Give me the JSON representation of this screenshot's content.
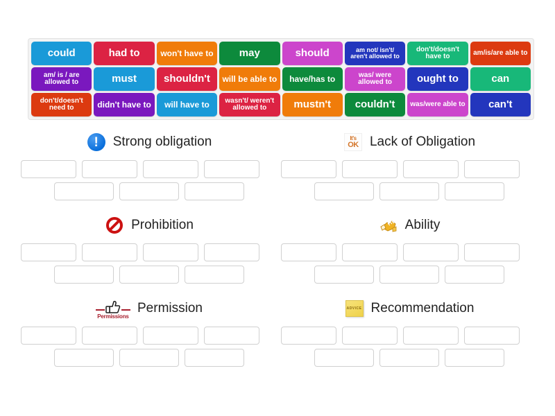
{
  "tile_bank": {
    "rows": [
      [
        {
          "label": "could",
          "color": "#1a9ad8",
          "size": "big"
        },
        {
          "label": "had to",
          "color": "#dc2343",
          "size": "big"
        },
        {
          "label": "won't have to",
          "color": "#f07c0a",
          "size": "mid"
        },
        {
          "label": "may",
          "color": "#0d8a3c",
          "size": "big"
        },
        {
          "label": "should",
          "color": "#cc45cc",
          "size": "big"
        },
        {
          "label": "am not/ isn't/ aren't allowed to",
          "color": "#2336bd",
          "size": "tiny"
        },
        {
          "label": "don't/doesn't have to",
          "color": "#18b879",
          "size": "small"
        },
        {
          "label": "am/is/are able to",
          "color": "#dc3a10",
          "size": "small"
        }
      ],
      [
        {
          "label": "am/ is / are allowed to",
          "color": "#7a18be",
          "size": "small"
        },
        {
          "label": "must",
          "color": "#1a9ad8",
          "size": "big"
        },
        {
          "label": "shouldn't",
          "color": "#dc2343",
          "size": "big"
        },
        {
          "label": "will be able to",
          "color": "#f07c0a",
          "size": "mid"
        },
        {
          "label": "have/has to",
          "color": "#0d8a3c",
          "size": "mid"
        },
        {
          "label": "was/ were allowed to",
          "color": "#cc45cc",
          "size": "small"
        },
        {
          "label": "ought to",
          "color": "#2336bd",
          "size": "big"
        },
        {
          "label": "can",
          "color": "#18b879",
          "size": "big"
        }
      ],
      [
        {
          "label": "don't/doesn't need to",
          "color": "#dc3a10",
          "size": "small"
        },
        {
          "label": "didn't have to",
          "color": "#7a18be",
          "size": "mid"
        },
        {
          "label": "will have to",
          "color": "#1a9ad8",
          "size": "mid"
        },
        {
          "label": "wasn't/ weren't allowed to",
          "color": "#dc2343",
          "size": "small"
        },
        {
          "label": "mustn't",
          "color": "#f07c0a",
          "size": "big"
        },
        {
          "label": "couldn't",
          "color": "#0d8a3c",
          "size": "big"
        },
        {
          "label": "was/were able to",
          "color": "#cc45cc",
          "size": "small"
        },
        {
          "label": "can't",
          "color": "#2336bd",
          "size": "big"
        }
      ]
    ]
  },
  "categories": [
    {
      "title": "Strong obligation",
      "icon": "exclamation-circle-icon",
      "top_row_slots": 4,
      "bottom_row_slots": 3
    },
    {
      "title": "Lack of Obligation",
      "icon": "its-ok-icon",
      "icon_text_line1": "It's",
      "icon_text_line2": "OK",
      "top_row_slots": 4,
      "bottom_row_slots": 3
    },
    {
      "title": "Prohibition",
      "icon": "prohibition-icon",
      "top_row_slots": 4,
      "bottom_row_slots": 3
    },
    {
      "title": "Ability",
      "icon": "flexed-hand-icon",
      "top_row_slots": 4,
      "bottom_row_slots": 3
    },
    {
      "title": "Permission",
      "icon": "thumbs-up-permissions-icon",
      "icon_label": "Permissions",
      "top_row_slots": 4,
      "bottom_row_slots": 3
    },
    {
      "title": "Recommendation",
      "icon": "advice-sticky-note-icon",
      "icon_text": "ADVICE",
      "top_row_slots": 4,
      "bottom_row_slots": 3
    }
  ],
  "colors": {
    "page_background": "#ffffff",
    "bank_background": "#f3f3f3",
    "dropzone_border": "#d0d0d0",
    "title_text": "#222222"
  }
}
